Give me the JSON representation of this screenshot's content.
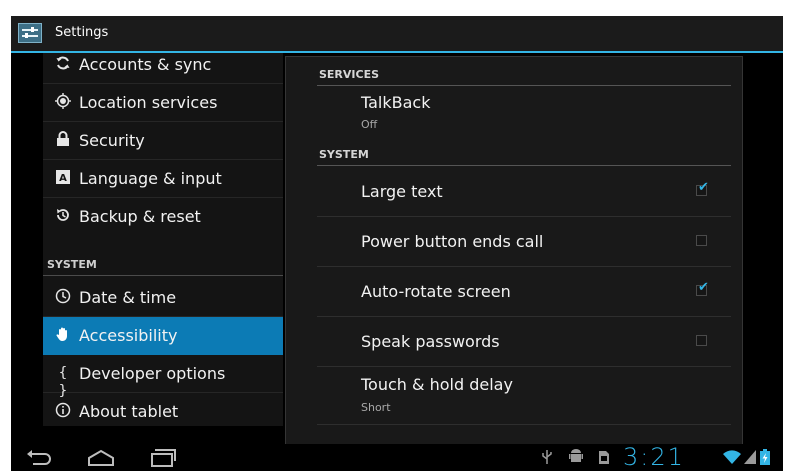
{
  "action_bar": {
    "title": "Settings",
    "icon": "settings-sliders-icon"
  },
  "left_list": {
    "items_top": [
      {
        "label": "Accounts & sync",
        "icon": "sync-icon"
      },
      {
        "label": "Location services",
        "icon": "location-icon"
      },
      {
        "label": "Security",
        "icon": "lock-icon"
      },
      {
        "label": "Language & input",
        "icon": "keyboard-a-icon"
      },
      {
        "label": "Backup & reset",
        "icon": "backup-icon"
      }
    ],
    "section_system": "SYSTEM",
    "items_system": [
      {
        "label": "Date & time",
        "icon": "clock-icon"
      },
      {
        "label": "Accessibility",
        "icon": "hand-icon",
        "selected": true
      },
      {
        "label": "Developer options",
        "icon": "braces-icon"
      },
      {
        "label": "About tablet",
        "icon": "info-icon"
      }
    ]
  },
  "right_panel": {
    "section_services": "SERVICES",
    "talkback": {
      "title": "TalkBack",
      "summary": "Off"
    },
    "section_system": "SYSTEM",
    "options": [
      {
        "title": "Large text",
        "checked": true
      },
      {
        "title": "Power button ends call",
        "checked": false
      },
      {
        "title": "Auto-rotate screen",
        "checked": true
      },
      {
        "title": "Speak passwords",
        "checked": false
      }
    ],
    "touch_hold": {
      "title": "Touch & hold delay",
      "summary": "Short"
    }
  },
  "status_bar": {
    "time": "3:21"
  },
  "colors": {
    "accent": "#33b5e5",
    "selected": "#0c7bb5"
  }
}
